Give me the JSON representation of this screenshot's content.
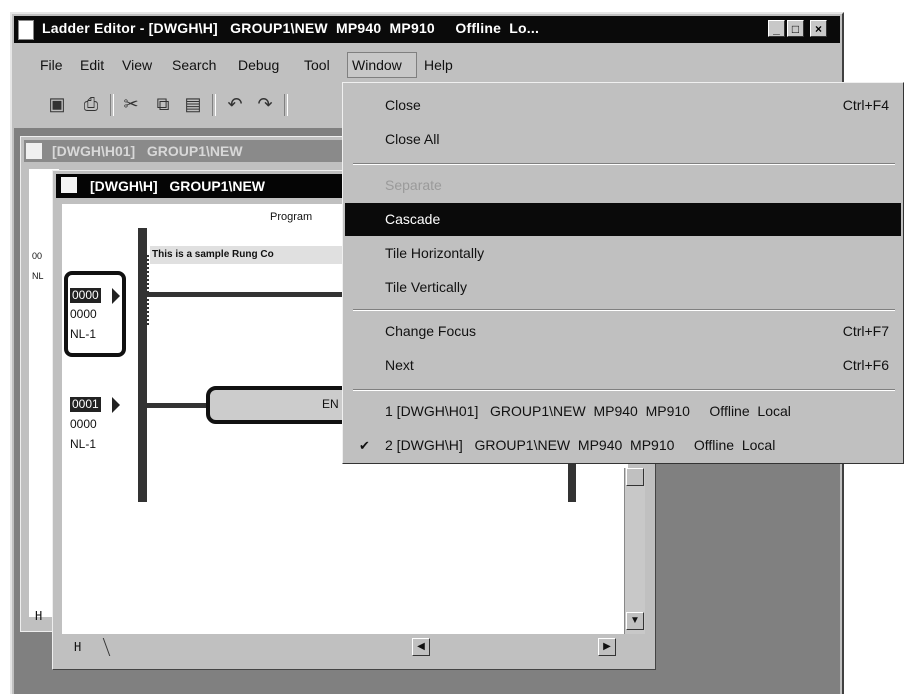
{
  "window": {
    "title": "Ladder Editor - [DWGH\\H]   GROUP1\\NEW  MP940  MP910     Offline  Lo...",
    "caption_buttons": [
      "_",
      "□",
      "×"
    ]
  },
  "menubar": {
    "items": [
      "File",
      "Edit",
      "View",
      "Search",
      "Debug",
      "Tool",
      "Window",
      "Help"
    ]
  },
  "toolbar": {
    "icons": [
      "save-icon",
      "print-icon",
      "cut-icon",
      "copy-icon",
      "paste-icon",
      "undo-icon",
      "redo-icon"
    ],
    "glyphs": [
      "▣",
      "⎙",
      "✂",
      "⧉",
      "▤",
      "↶",
      "↷"
    ]
  },
  "child1": {
    "title": "[DWGH\\H01]   GROUP1\\NEW",
    "labels": [
      "00",
      "NL",
      "H"
    ]
  },
  "child2": {
    "title": "[DWGH\\H]   GROUP1\\NEW",
    "program_label": "Program",
    "rung_comment": "This is a sample Rung Co",
    "rung1": [
      "0000",
      "0000",
      "NL-1"
    ],
    "rung2": [
      "0001",
      "0000",
      "NL-1"
    ],
    "block_text": "EN",
    "tab_label": "H"
  },
  "window_menu": {
    "items": [
      {
        "label": "Close",
        "shortcut": "Ctrl+F4"
      },
      {
        "label": "Close All",
        "shortcut": ""
      },
      {
        "label": "Separate",
        "shortcut": ""
      },
      {
        "label": "Cascade",
        "shortcut": ""
      },
      {
        "label": "Tile Horizontally",
        "shortcut": ""
      },
      {
        "label": "Tile Vertically",
        "shortcut": ""
      },
      {
        "label": "Change Focus",
        "shortcut": "Ctrl+F7"
      },
      {
        "label": "Next",
        "shortcut": "Ctrl+F6"
      },
      {
        "label": "1 [DWGH\\H01]   GROUP1\\NEW  MP940  MP910     Offline  Local",
        "shortcut": ""
      },
      {
        "label": "2 [DWGH\\H]   GROUP1\\NEW  MP940  MP910     Offline  Local",
        "shortcut": ""
      }
    ],
    "checked_mark": "✔",
    "highlight_color": "#0a0a0a",
    "disabled_color": "#9a9a9a"
  }
}
